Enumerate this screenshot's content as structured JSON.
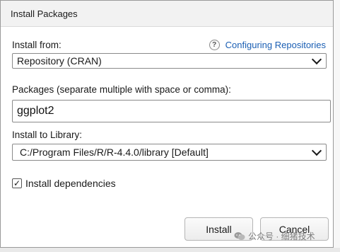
{
  "dialog": {
    "title": "Install Packages"
  },
  "install_from": {
    "label": "Install from:",
    "help_link": "Configuring Repositories",
    "selected": "Repository (CRAN)"
  },
  "packages": {
    "label": "Packages (separate multiple with space or comma):",
    "value": "ggplot2"
  },
  "library": {
    "label": "Install to Library:",
    "selected": "C:/Program Files/R/R-4.4.0/library [Default]"
  },
  "dependencies": {
    "label": "Install dependencies",
    "checked": true,
    "check_mark": "✓"
  },
  "buttons": {
    "install": "Install",
    "cancel": "Cancel"
  },
  "watermark": {
    "text": "公众号 · 细猪技术"
  },
  "icons": {
    "help": "question-mark-icon",
    "dropdown": "chevron-down-icon",
    "check": "checkmark-icon"
  },
  "colors": {
    "link": "#1b5fb4",
    "titlebar": "#f2f2f2",
    "dialog_bg": "#ffffff"
  }
}
